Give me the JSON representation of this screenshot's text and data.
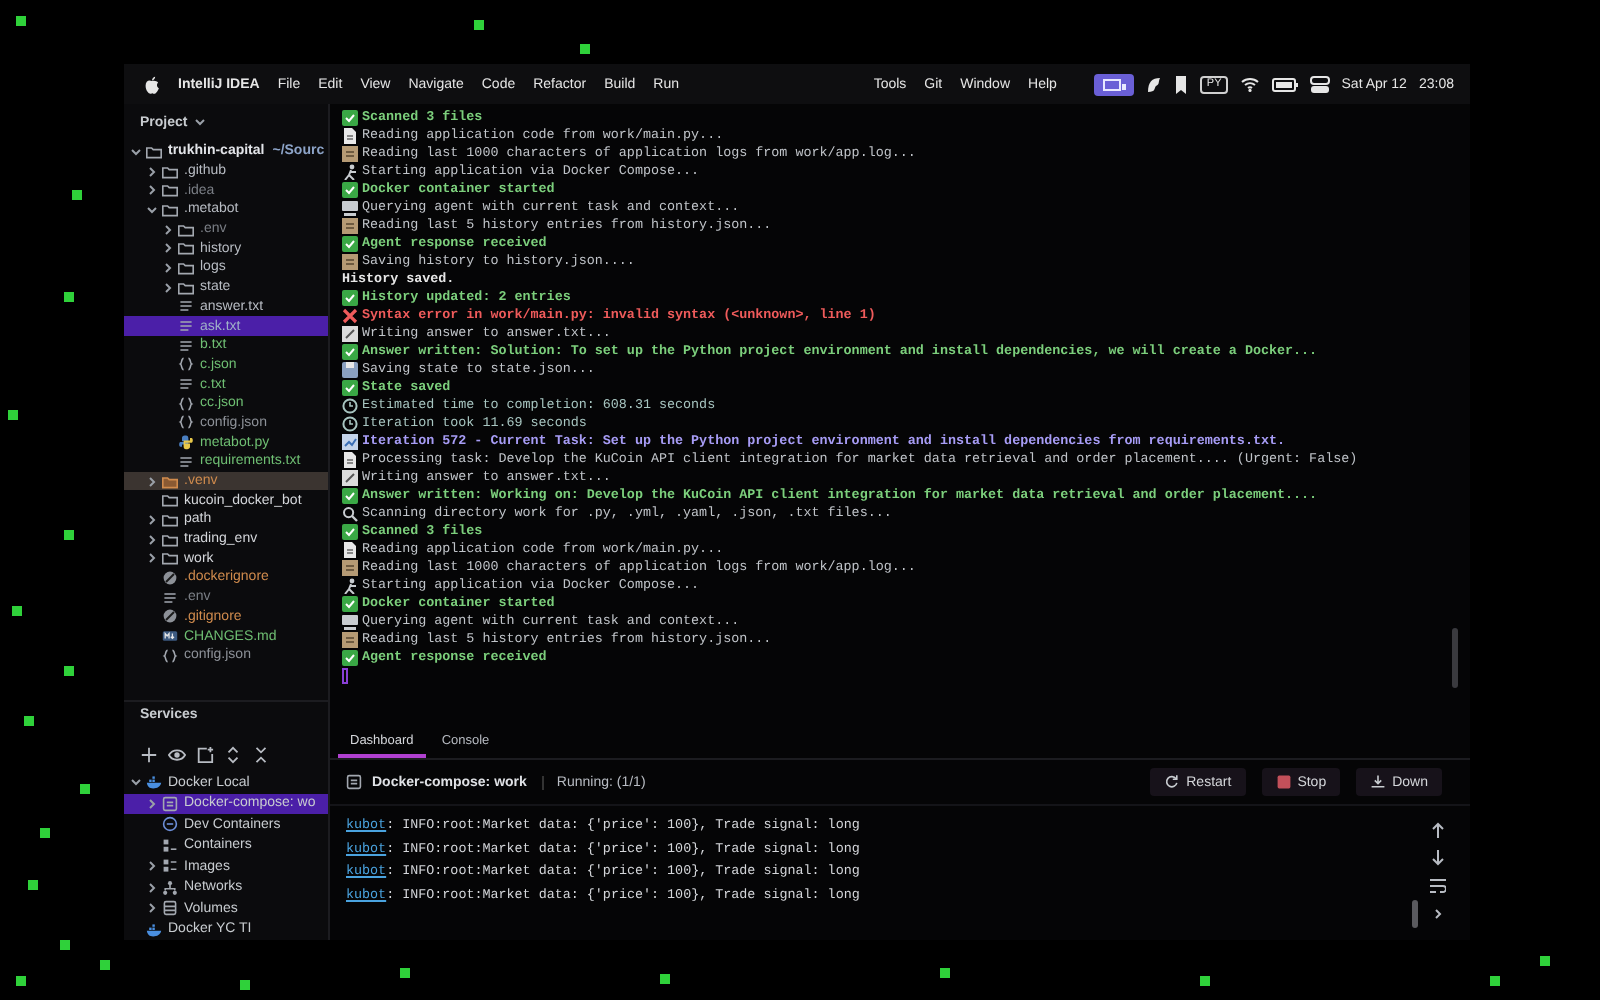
{
  "menu_bar": {
    "app_name": "IntelliJ IDEA",
    "menus": [
      "File",
      "Edit",
      "View",
      "Navigate",
      "Code",
      "Refactor",
      "Build",
      "Run"
    ],
    "right_menus": [
      "Tools",
      "Git",
      "Window",
      "Help"
    ],
    "input_badge": "PY",
    "date": "Sat Apr 12",
    "time": "23:08"
  },
  "project": {
    "title": "Project",
    "tree": [
      {
        "label": "trukhin-capital",
        "path": "~/Sourc",
        "kind": "folder",
        "color": "#e2e4e8",
        "expanded": true,
        "selected": false,
        "children": [
          {
            "label": ".github",
            "kind": "folder",
            "color": "#b8bcc3",
            "expanded": false,
            "selected": false
          },
          {
            "label": ".idea",
            "kind": "folder",
            "color": "#7b7f86",
            "expanded": false,
            "selected": false
          },
          {
            "label": ".metabot",
            "kind": "folder",
            "color": "#b8bcc3",
            "expanded": true,
            "selected": false,
            "children": [
              {
                "label": ".env",
                "kind": "folder",
                "color": "#7b7f86",
                "expanded": false,
                "selected": false
              },
              {
                "label": "history",
                "kind": "folder",
                "color": "#b8bcc3",
                "expanded": false,
                "selected": false
              },
              {
                "label": "logs",
                "kind": "folder",
                "color": "#b8bcc3",
                "expanded": false,
                "selected": false
              },
              {
                "label": "state",
                "kind": "folder",
                "color": "#b8bcc3",
                "expanded": false,
                "selected": false
              },
              {
                "label": "answer.txt",
                "kind": "text",
                "color": "#b8bcc3",
                "selected": false
              },
              {
                "label": "ask.txt",
                "kind": "text",
                "color": "#9fb0c8",
                "selected": true
              },
              {
                "label": "b.txt",
                "kind": "text",
                "color": "#6fbf73",
                "selected": false
              },
              {
                "label": "c.json",
                "kind": "json",
                "color": "#6fbf73",
                "selected": false
              },
              {
                "label": "c.txt",
                "kind": "text",
                "color": "#6fbf73",
                "selected": false
              },
              {
                "label": "cc.json",
                "kind": "json",
                "color": "#6fbf73",
                "selected": false
              },
              {
                "label": "config.json",
                "kind": "json",
                "color": "#8d9198",
                "selected": false
              },
              {
                "label": "metabot.py",
                "kind": "python",
                "color": "#6fbf73",
                "selected": false
              },
              {
                "label": "requirements.txt",
                "kind": "text",
                "color": "#6fbf73",
                "selected": false
              }
            ]
          },
          {
            "label": ".venv",
            "kind": "excluded-folder",
            "color": "#d08b4d",
            "expanded": false,
            "selected": false
          },
          {
            "label": "kucoin_docker_bot",
            "kind": "folder",
            "color": "#d4d6da",
            "selected": false
          },
          {
            "label": "path",
            "kind": "folder",
            "color": "#d4d6da",
            "expanded": false,
            "selected": false
          },
          {
            "label": "trading_env",
            "kind": "folder",
            "color": "#d4d6da",
            "expanded": false,
            "selected": false
          },
          {
            "label": "work",
            "kind": "folder",
            "color": "#d4d6da",
            "expanded": false,
            "selected": false
          },
          {
            "label": ".dockerignore",
            "kind": "ignore",
            "color": "#d08b4d",
            "selected": false
          },
          {
            "label": ".env",
            "kind": "text",
            "color": "#7b7f86",
            "selected": false
          },
          {
            "label": ".gitignore",
            "kind": "ignore",
            "color": "#d08b4d",
            "selected": false
          },
          {
            "label": "CHANGES.md",
            "kind": "markdown",
            "color": "#6fbf73",
            "selected": false
          },
          {
            "label": "config.json",
            "kind": "json",
            "color": "#8d9198",
            "selected": false
          }
        ]
      }
    ]
  },
  "terminal": {
    "lines": [
      {
        "kind": "success",
        "text": "Scanned 3 files"
      },
      {
        "kind": "read",
        "text": "Reading application code from work/main.py..."
      },
      {
        "kind": "log",
        "text": "Reading last 1000 characters of application logs from work/app.log..."
      },
      {
        "kind": "run",
        "text": "Starting application via Docker Compose..."
      },
      {
        "kind": "success",
        "text": "Docker container started"
      },
      {
        "kind": "query",
        "text": "Querying agent with current task and context..."
      },
      {
        "kind": "log",
        "text": "Reading last 5 history entries from history.json..."
      },
      {
        "kind": "success",
        "text": "Agent response received"
      },
      {
        "kind": "log",
        "text": "Saving history to history.json...."
      },
      {
        "kind": "plain",
        "text": "History saved."
      },
      {
        "kind": "success",
        "text": "History updated: 2 entries"
      },
      {
        "kind": "error",
        "text": "Syntax error in work/main.py: invalid syntax (<unknown>, line 1)"
      },
      {
        "kind": "write",
        "text": "Writing answer to answer.txt..."
      },
      {
        "kind": "success",
        "text": "Answer written: Solution: To set up the Python project environment and install dependencies, we will create a Docker..."
      },
      {
        "kind": "save",
        "text": "Saving state to state.json..."
      },
      {
        "kind": "success",
        "text": "State saved"
      },
      {
        "kind": "time",
        "text": "Estimated time to completion: 608.31 seconds"
      },
      {
        "kind": "time",
        "text": "Iteration took 11.69 seconds"
      },
      {
        "kind": "iteration",
        "text": "Iteration 572 - Current Task: Set up the Python project environment and install dependencies from requirements.txt."
      },
      {
        "kind": "read",
        "text": "Processing task: Develop the KuCoin API client integration for market data retrieval and order placement.... (Urgent: False)"
      },
      {
        "kind": "write",
        "text": "Writing answer to answer.txt..."
      },
      {
        "kind": "success",
        "text": "Answer written: Working on: Develop the KuCoin API client integration for market data retrieval and order placement...."
      },
      {
        "kind": "search",
        "text": "Scanning directory work for .py, .yml, .yaml, .json, .txt files..."
      },
      {
        "kind": "success",
        "text": "Scanned 3 files"
      },
      {
        "kind": "read",
        "text": "Reading application code from work/main.py..."
      },
      {
        "kind": "log",
        "text": "Reading last 1000 characters of application logs from work/app.log..."
      },
      {
        "kind": "run",
        "text": "Starting application via Docker Compose..."
      },
      {
        "kind": "success",
        "text": "Docker container started"
      },
      {
        "kind": "query",
        "text": "Querying agent with current task and context..."
      },
      {
        "kind": "log",
        "text": "Reading last 5 history entries from history.json..."
      },
      {
        "kind": "success",
        "text": "Agent response received"
      }
    ]
  },
  "services": {
    "title": "Services",
    "tree": [
      {
        "label": "Docker Local",
        "kind": "docker",
        "expanded": true,
        "selected": false,
        "children": [
          {
            "label": "Docker-compose: wo",
            "kind": "compose",
            "expanded": false,
            "selected": true
          },
          {
            "label": "Dev Containers",
            "kind": "dev-containers",
            "selected": false
          },
          {
            "label": "Containers",
            "kind": "containers",
            "selected": false
          },
          {
            "label": "Images",
            "kind": "images",
            "expanded": false,
            "selected": false
          },
          {
            "label": "Networks",
            "kind": "networks",
            "expanded": false,
            "selected": false
          },
          {
            "label": "Volumes",
            "kind": "volumes",
            "expanded": false,
            "selected": false
          }
        ]
      },
      {
        "label": "Docker YC TI",
        "kind": "docker",
        "selected": false
      }
    ]
  },
  "dashboard": {
    "tabs": [
      {
        "label": "Dashboard",
        "selected": true
      },
      {
        "label": "Console",
        "selected": false
      }
    ],
    "service_name": "Docker-compose: work",
    "status": "Running: (1/1)",
    "buttons": [
      {
        "kind": "restart",
        "label": "Restart"
      },
      {
        "kind": "stop",
        "label": "Stop"
      },
      {
        "kind": "down",
        "label": "Down"
      }
    ],
    "logs": [
      {
        "source": "kubot",
        "message": ": INFO:root:Market data: {'price': 100}, Trade signal: long"
      },
      {
        "source": "kubot",
        "message": ": INFO:root:Market data: {'price': 100}, Trade signal: long"
      },
      {
        "source": "kubot",
        "message": ": INFO:root:Market data: {'price': 100}, Trade signal: long"
      },
      {
        "source": "kubot",
        "message": ": INFO:root:Market data: {'price': 100}, Trade signal: long"
      }
    ]
  }
}
